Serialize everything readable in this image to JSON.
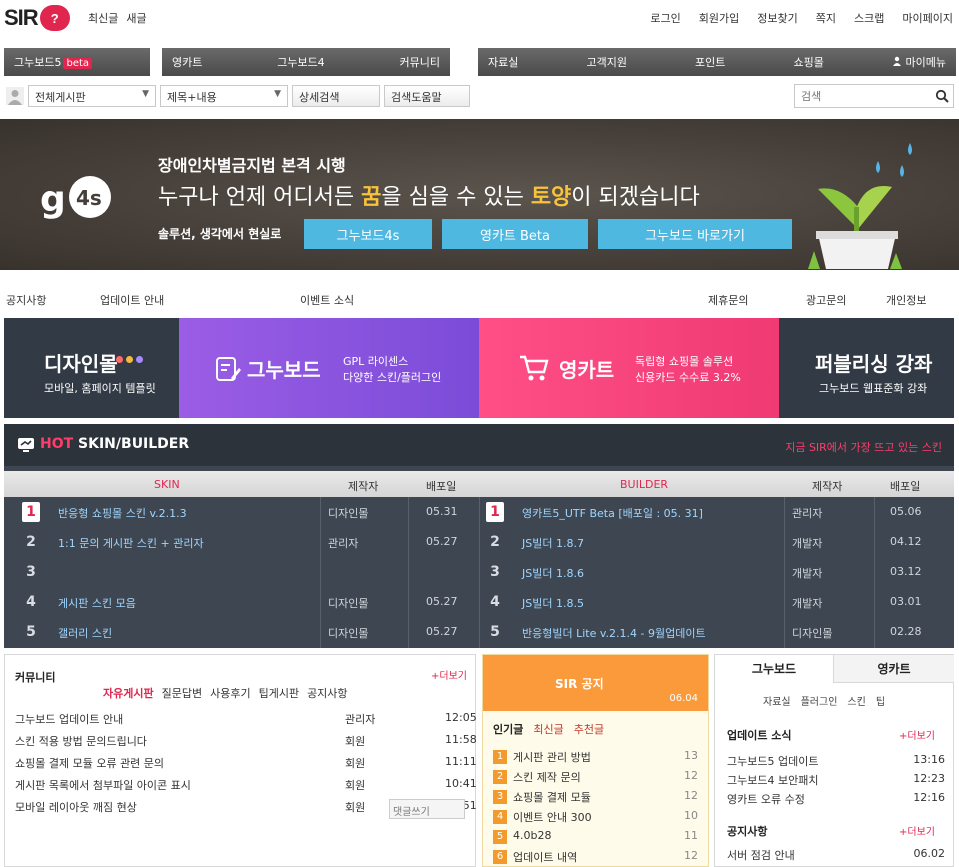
{
  "header": {
    "logo_text": "SIR",
    "logo_badge": "?",
    "left_links": [
      "최신글",
      "새글"
    ],
    "right_links": [
      "로그인",
      "회원가입",
      "정보찾기",
      "쪽지",
      "스크랩",
      "마이페이지"
    ]
  },
  "nav": {
    "group_a": {
      "label": "그누보드5",
      "beta": "beta"
    },
    "group_b": [
      "영카트",
      "그누보드4",
      "커뮤니티"
    ],
    "group_c": [
      "자료실",
      "고객지원",
      "포인트",
      "쇼핑몰",
      "마이메뉴"
    ]
  },
  "subbar": {
    "select1": "전체게시판",
    "select2": "제목+내용",
    "btn1": "상세검색",
    "btn2": "검색도움말",
    "search_placeholder": "검색"
  },
  "hero": {
    "logo": "g4s",
    "title": "장애인차별금지법 본격 시행",
    "sub_pre": "누구나 언제 어디서든 ",
    "sub_hl1": "꿈",
    "sub_mid": "을 심을 수 있는 ",
    "sub_hl2": "토양",
    "sub_post": "이 되겠습니다",
    "caption": "솔루션, 생각에서 현실로",
    "buttons": [
      "그누보드4s",
      "영카트 Beta",
      "그누보드 바로가기"
    ]
  },
  "linkrow": {
    "left": [
      "공지사항",
      "업데이트 안내",
      "이벤트 소식"
    ],
    "right": [
      "제휴문의",
      "광고문의",
      "개인정보"
    ]
  },
  "products": {
    "p1_title": "디자인몰",
    "p1_sub": "모바일, 홈페이지 템플릿",
    "p2_title": "그누보드",
    "p2_desc1": "GPL 라이센스",
    "p2_desc2": "다양한 스킨/플러그인",
    "p3_title": "영카트",
    "p3_desc1": "독립형 쇼핑몰 솔루션",
    "p3_desc2": "신용카드 수수료 3.2%",
    "p4_title": "퍼블리싱 강좌",
    "p4_sub": "그누보드 웹표준화 강좌",
    "dot_colors": [
      "#ff6b6b",
      "#f5b941",
      "#a78bfa"
    ]
  },
  "hot": {
    "title_a": "HOT",
    "title_b": " SKIN/BUILDER",
    "right_text": "지금 SIR에서 가장 뜨고 있는 스킨",
    "col_skin": "SKIN",
    "col_maker": "제작자",
    "col_date": "배포일",
    "col_builder": "BUILDER",
    "skins": [
      {
        "rank": "1",
        "name": "반응형 쇼핑몰 스킨 v.2.1.3",
        "maker": "디자인몰",
        "date": "05.31"
      },
      {
        "rank": "2",
        "name": "1:1 문의 게시판 스킨 + 관리자",
        "maker": "관리자",
        "date": "05.27"
      },
      {
        "rank": "3",
        "name": "",
        "maker": "",
        "date": ""
      },
      {
        "rank": "4",
        "name": "게시판 스킨 모음",
        "maker": "디자인몰",
        "date": "05.27"
      },
      {
        "rank": "5",
        "name": "갤러리 스킨",
        "maker": "디자인몰",
        "date": "05.27"
      }
    ],
    "builders": [
      {
        "rank": "1",
        "name": "영카트5_UTF Beta [배포일 : 05. 31]",
        "maker": "관리자",
        "date": "05.06"
      },
      {
        "rank": "2",
        "name": "JS빌더 1.8.7",
        "maker": "개발자",
        "date": "04.12"
      },
      {
        "rank": "3",
        "name": "JS빌더 1.8.6",
        "maker": "개발자",
        "date": "03.12"
      },
      {
        "rank": "4",
        "name": "JS빌더 1.8.5",
        "maker": "개발자",
        "date": "03.01"
      },
      {
        "rank": "5",
        "name": "반응형빌더 Lite v.2.1.4 - 9월업데이트",
        "maker": "디자인몰",
        "date": "02.28"
      }
    ]
  },
  "panel1": {
    "title": "커뮤니티",
    "more": "+더보기",
    "tabs": [
      "자유게시판",
      "질문답변",
      "사용후기",
      "팁게시판",
      "공지사항"
    ],
    "posts": [
      {
        "t": "그누보드 업데이트 안내",
        "a": "관리자",
        "d": "12:05"
      },
      {
        "t": "스킨 적용 방법 문의드립니다",
        "a": "회원",
        "d": "11:58"
      },
      {
        "t": "쇼핑몰 결제 모듈 오류 관련 문의",
        "a": "회원",
        "d": "11:11"
      },
      {
        "t": "게시판 목록에서 첨부파일 아이콘 표시",
        "a": "회원",
        "d": "10:41"
      },
      {
        "t": "모바일 레이아웃 깨짐 현상",
        "a": "회원",
        "d": "00:51"
      }
    ],
    "comment_label": "댓글쓰기"
  },
  "panel2": {
    "title": "SIR 공지",
    "date": "06.04",
    "tabs": [
      "인기글",
      "최신글",
      "추천글"
    ],
    "items": [
      {
        "n": "1",
        "t": "게시판 관리 방법",
        "c": "13"
      },
      {
        "n": "2",
        "t": "스킨 제작 문의",
        "c": "12"
      },
      {
        "n": "3",
        "t": "쇼핑몰 결제 모듈",
        "c": "12"
      },
      {
        "n": "4",
        "t": "이벤트 안내 300",
        "c": "10"
      },
      {
        "n": "5",
        "t": "4.0b28",
        "c": "11"
      },
      {
        "n": "6",
        "t": "업데이트 내역",
        "c": "12"
      }
    ]
  },
  "panel3": {
    "tab_active": "그누보드",
    "tab_other": "영카트",
    "sublinks": [
      "자료실",
      "플러그인",
      "스킨",
      "팁"
    ],
    "section1_title": "업데이트 소식",
    "section1_more": "+더보기",
    "rows1": [
      {
        "t": "그누보드5 업데이트",
        "d": "13:16"
      },
      {
        "t": "그누보드4 보안패치",
        "d": "12:23"
      },
      {
        "t": "영카트 오류 수정",
        "d": "12:16"
      }
    ],
    "section2_title": "공지사항",
    "section2_more": "+더보기",
    "rows2": [
      {
        "t": "서버 점검 안내",
        "d": "06.02"
      }
    ]
  }
}
